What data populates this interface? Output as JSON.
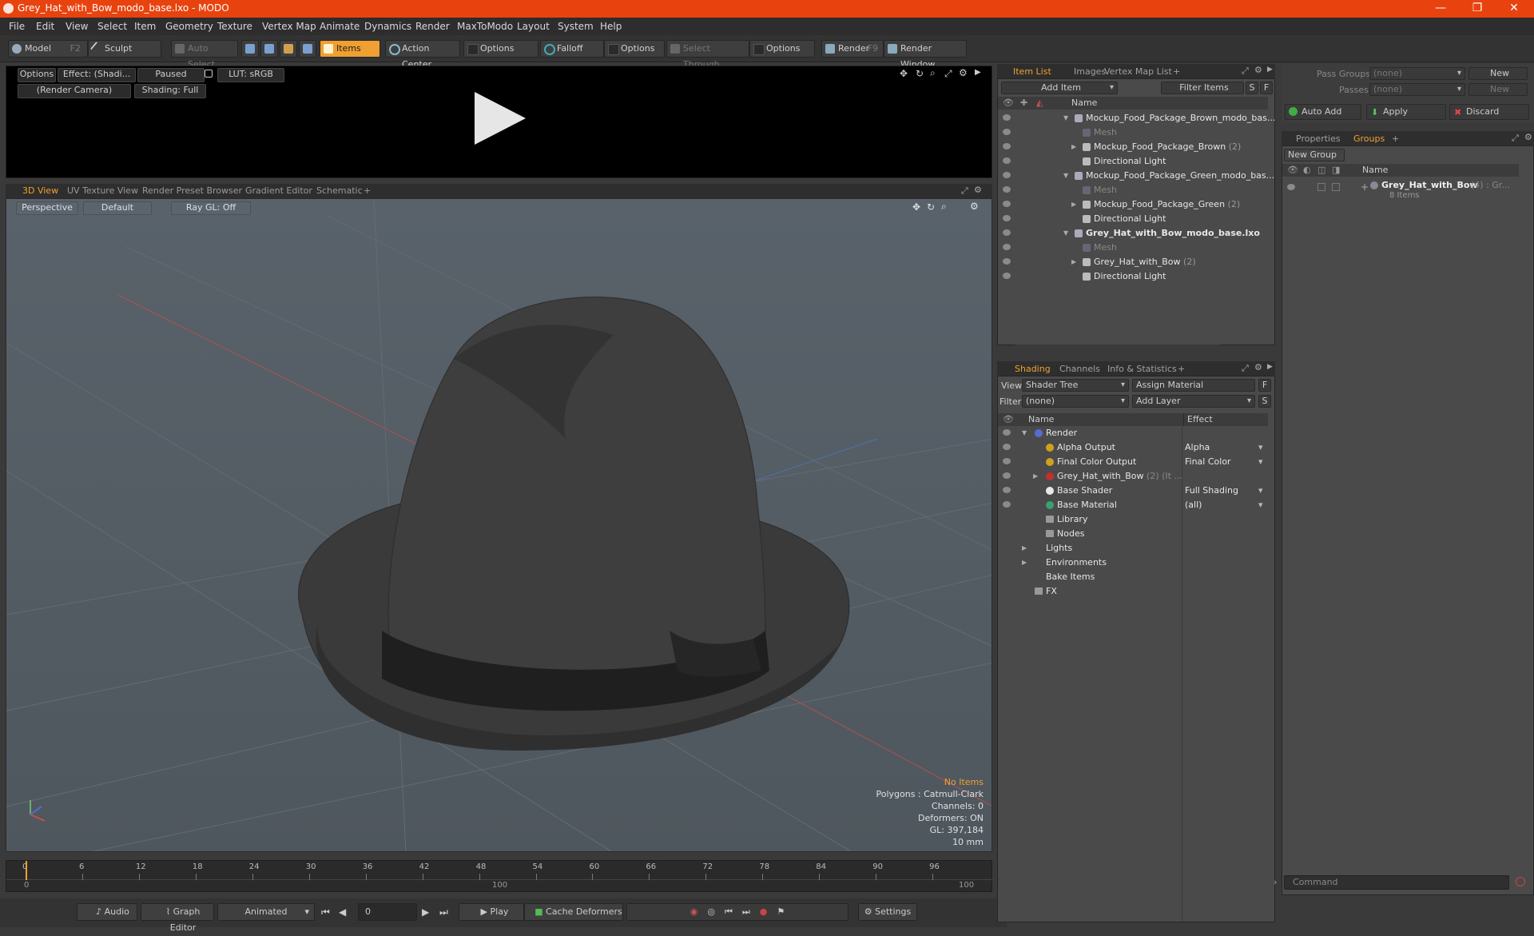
{
  "window": {
    "title": "Grey_Hat_with_Bow_modo_base.lxo - MODO",
    "minimize": "—",
    "restore": "❐",
    "close": "✕"
  },
  "menu": [
    "File",
    "Edit",
    "View",
    "Select",
    "Item",
    "Geometry",
    "Texture",
    "Vertex Map",
    "Animate",
    "Dynamics",
    "Render",
    "MaxToModo",
    "Layout",
    "System",
    "Help"
  ],
  "toolbar": {
    "model": "Model",
    "model_key": "F2",
    "sculpt": "Sculpt",
    "auto_select": "Auto Select",
    "items": "Items",
    "action_center": "Action Center",
    "options1": "Options",
    "falloff": "Falloff",
    "options2": "Options",
    "select_through": "Select Through",
    "options3": "Options",
    "render": "Render",
    "render_key": "F9",
    "render_window": "Render Window"
  },
  "preview": {
    "options": "Options",
    "effect": "Effect: (Shadi...",
    "paused": "Paused",
    "lut": "LUT: sRGB",
    "camera": "(Render Camera)",
    "shading": "Shading: Full"
  },
  "view_tabs": [
    "3D View",
    "UV Texture View",
    "Render Preset Browser",
    "Gradient Editor",
    "Schematic",
    "+"
  ],
  "viewport": {
    "perspective": "Perspective",
    "default": "Default",
    "raygl": "Ray GL: Off",
    "stats": {
      "items": "No Items",
      "polygons": "Polygons : Catmull-Clark",
      "channels": "Channels: 0",
      "deformers": "Deformers: ON",
      "gl": "GL: 397,184",
      "scale": "10 mm"
    }
  },
  "timeline": {
    "ticks": [
      "0",
      "6",
      "12",
      "18",
      "24",
      "30",
      "36",
      "42",
      "48",
      "54",
      "60",
      "66",
      "72",
      "78",
      "84",
      "90",
      "96"
    ],
    "lower_left": "0",
    "lower_mid": "100",
    "lower_right": "100"
  },
  "bottom": {
    "audio": "Audio",
    "graph_editor": "Graph Editor",
    "animated": "Animated",
    "frame": "0",
    "play": "Play",
    "cache": "Cache Deformers",
    "settings": "Settings"
  },
  "item_list": {
    "tabs": [
      "Item List",
      "Images",
      "Vertex Map List",
      "+"
    ],
    "add_item": "Add Item",
    "filter": "Filter Items",
    "s": "S",
    "f": "F",
    "name_col": "Name",
    "rows": [
      {
        "label": "Mockup_Food_Package_Brown_modo_bas...",
        "indent": 0,
        "style": "normal"
      },
      {
        "label": "Mesh",
        "indent": 1,
        "style": "gray"
      },
      {
        "label": "Mockup_Food_Package_Brown",
        "count": "(2)",
        "indent": 1,
        "style": "normal"
      },
      {
        "label": "Directional Light",
        "indent": 1,
        "style": "normal"
      },
      {
        "label": "Mockup_Food_Package_Green_modo_bas...",
        "indent": 0,
        "style": "normal"
      },
      {
        "label": "Mesh",
        "indent": 1,
        "style": "gray"
      },
      {
        "label": "Mockup_Food_Package_Green",
        "count": "(2)",
        "indent": 1,
        "style": "normal"
      },
      {
        "label": "Directional Light",
        "indent": 1,
        "style": "normal"
      },
      {
        "label": "Grey_Hat_with_Bow_modo_base.lxo",
        "indent": 0,
        "style": "bold"
      },
      {
        "label": "Mesh",
        "indent": 1,
        "style": "gray"
      },
      {
        "label": "Grey_Hat_with_Bow",
        "count": "(2)",
        "indent": 1,
        "style": "normal"
      },
      {
        "label": "Directional Light",
        "indent": 1,
        "style": "normal"
      }
    ]
  },
  "shading": {
    "tabs": [
      "Shading",
      "Channels",
      "Info & Statistics",
      "+"
    ],
    "view_label": "View",
    "view_value": "Shader Tree",
    "assign": "Assign Material",
    "f": "F",
    "filter_label": "Filter",
    "filter_value": "(none)",
    "add_layer": "Add Layer",
    "s": "S",
    "name_col": "Name",
    "effect_col": "Effect",
    "rows": [
      {
        "label": "Render",
        "effect": "",
        "indent": 0,
        "color": "#5a6bd0"
      },
      {
        "label": "Alpha Output",
        "effect": "Alpha",
        "indent": 1,
        "color": "#d0a020"
      },
      {
        "label": "Final Color Output",
        "effect": "Final Color",
        "indent": 1,
        "color": "#d0a020"
      },
      {
        "label": "Grey_Hat_with_Bow",
        "count": "(2) (It ...",
        "effect": "",
        "indent": 1,
        "color": "#c03030"
      },
      {
        "label": "Base Shader",
        "effect": "Full Shading",
        "indent": 1,
        "color": "#e8e8e8"
      },
      {
        "label": "Base Material",
        "effect": "(all)",
        "indent": 1,
        "color": "#3aa070"
      },
      {
        "label": "Library",
        "effect": "",
        "indent": 1,
        "color": ""
      },
      {
        "label": "Nodes",
        "effect": "",
        "indent": 1,
        "color": ""
      },
      {
        "label": "Lights",
        "effect": "",
        "indent": 0,
        "color": ""
      },
      {
        "label": "Environments",
        "effect": "",
        "indent": 0,
        "color": ""
      },
      {
        "label": "Bake Items",
        "effect": "",
        "indent": 0,
        "color": ""
      },
      {
        "label": "FX",
        "effect": "",
        "indent": 0,
        "color": ""
      }
    ]
  },
  "groups": {
    "pass_groups": "Pass Groups",
    "pass_groups_value": "(none)",
    "new": "New",
    "passes": "Passes",
    "passes_value": "(none)",
    "new2": "New",
    "auto_add": "Auto Add",
    "apply": "Apply",
    "discard": "Discard",
    "tabs": [
      "Properties",
      "Groups",
      "+"
    ],
    "new_group": "New Group",
    "name_col": "Name",
    "item_label": "Grey_Hat_with_Bow",
    "item_count": "(4) : Gr...",
    "item_sub": "8 Items"
  },
  "command": {
    "placeholder": "Command"
  },
  "colors": {
    "accent": "#f0a030",
    "title": "#e8430f"
  }
}
